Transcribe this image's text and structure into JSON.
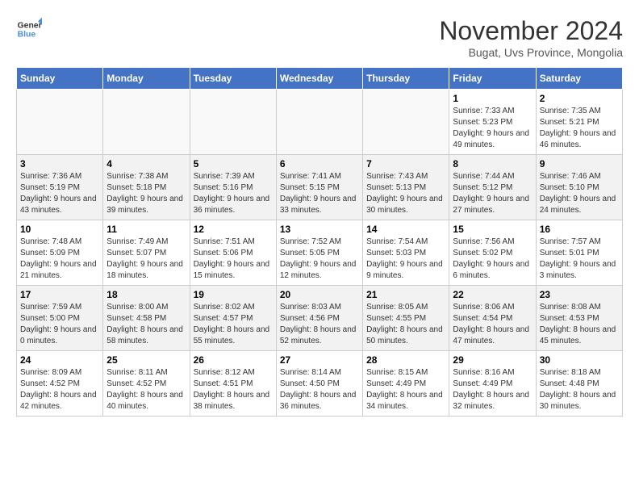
{
  "logo": {
    "line1": "General",
    "line2": "Blue"
  },
  "title": "November 2024",
  "subtitle": "Bugat, Uvs Province, Mongolia",
  "days_of_week": [
    "Sunday",
    "Monday",
    "Tuesday",
    "Wednesday",
    "Thursday",
    "Friday",
    "Saturday"
  ],
  "weeks": [
    [
      {
        "day": "",
        "info": ""
      },
      {
        "day": "",
        "info": ""
      },
      {
        "day": "",
        "info": ""
      },
      {
        "day": "",
        "info": ""
      },
      {
        "day": "",
        "info": ""
      },
      {
        "day": "1",
        "info": "Sunrise: 7:33 AM\nSunset: 5:23 PM\nDaylight: 9 hours and 49 minutes."
      },
      {
        "day": "2",
        "info": "Sunrise: 7:35 AM\nSunset: 5:21 PM\nDaylight: 9 hours and 46 minutes."
      }
    ],
    [
      {
        "day": "3",
        "info": "Sunrise: 7:36 AM\nSunset: 5:19 PM\nDaylight: 9 hours and 43 minutes."
      },
      {
        "day": "4",
        "info": "Sunrise: 7:38 AM\nSunset: 5:18 PM\nDaylight: 9 hours and 39 minutes."
      },
      {
        "day": "5",
        "info": "Sunrise: 7:39 AM\nSunset: 5:16 PM\nDaylight: 9 hours and 36 minutes."
      },
      {
        "day": "6",
        "info": "Sunrise: 7:41 AM\nSunset: 5:15 PM\nDaylight: 9 hours and 33 minutes."
      },
      {
        "day": "7",
        "info": "Sunrise: 7:43 AM\nSunset: 5:13 PM\nDaylight: 9 hours and 30 minutes."
      },
      {
        "day": "8",
        "info": "Sunrise: 7:44 AM\nSunset: 5:12 PM\nDaylight: 9 hours and 27 minutes."
      },
      {
        "day": "9",
        "info": "Sunrise: 7:46 AM\nSunset: 5:10 PM\nDaylight: 9 hours and 24 minutes."
      }
    ],
    [
      {
        "day": "10",
        "info": "Sunrise: 7:48 AM\nSunset: 5:09 PM\nDaylight: 9 hours and 21 minutes."
      },
      {
        "day": "11",
        "info": "Sunrise: 7:49 AM\nSunset: 5:07 PM\nDaylight: 9 hours and 18 minutes."
      },
      {
        "day": "12",
        "info": "Sunrise: 7:51 AM\nSunset: 5:06 PM\nDaylight: 9 hours and 15 minutes."
      },
      {
        "day": "13",
        "info": "Sunrise: 7:52 AM\nSunset: 5:05 PM\nDaylight: 9 hours and 12 minutes."
      },
      {
        "day": "14",
        "info": "Sunrise: 7:54 AM\nSunset: 5:03 PM\nDaylight: 9 hours and 9 minutes."
      },
      {
        "day": "15",
        "info": "Sunrise: 7:56 AM\nSunset: 5:02 PM\nDaylight: 9 hours and 6 minutes."
      },
      {
        "day": "16",
        "info": "Sunrise: 7:57 AM\nSunset: 5:01 PM\nDaylight: 9 hours and 3 minutes."
      }
    ],
    [
      {
        "day": "17",
        "info": "Sunrise: 7:59 AM\nSunset: 5:00 PM\nDaylight: 9 hours and 0 minutes."
      },
      {
        "day": "18",
        "info": "Sunrise: 8:00 AM\nSunset: 4:58 PM\nDaylight: 8 hours and 58 minutes."
      },
      {
        "day": "19",
        "info": "Sunrise: 8:02 AM\nSunset: 4:57 PM\nDaylight: 8 hours and 55 minutes."
      },
      {
        "day": "20",
        "info": "Sunrise: 8:03 AM\nSunset: 4:56 PM\nDaylight: 8 hours and 52 minutes."
      },
      {
        "day": "21",
        "info": "Sunrise: 8:05 AM\nSunset: 4:55 PM\nDaylight: 8 hours and 50 minutes."
      },
      {
        "day": "22",
        "info": "Sunrise: 8:06 AM\nSunset: 4:54 PM\nDaylight: 8 hours and 47 minutes."
      },
      {
        "day": "23",
        "info": "Sunrise: 8:08 AM\nSunset: 4:53 PM\nDaylight: 8 hours and 45 minutes."
      }
    ],
    [
      {
        "day": "24",
        "info": "Sunrise: 8:09 AM\nSunset: 4:52 PM\nDaylight: 8 hours and 42 minutes."
      },
      {
        "day": "25",
        "info": "Sunrise: 8:11 AM\nSunset: 4:52 PM\nDaylight: 8 hours and 40 minutes."
      },
      {
        "day": "26",
        "info": "Sunrise: 8:12 AM\nSunset: 4:51 PM\nDaylight: 8 hours and 38 minutes."
      },
      {
        "day": "27",
        "info": "Sunrise: 8:14 AM\nSunset: 4:50 PM\nDaylight: 8 hours and 36 minutes."
      },
      {
        "day": "28",
        "info": "Sunrise: 8:15 AM\nSunset: 4:49 PM\nDaylight: 8 hours and 34 minutes."
      },
      {
        "day": "29",
        "info": "Sunrise: 8:16 AM\nSunset: 4:49 PM\nDaylight: 8 hours and 32 minutes."
      },
      {
        "day": "30",
        "info": "Sunrise: 8:18 AM\nSunset: 4:48 PM\nDaylight: 8 hours and 30 minutes."
      }
    ]
  ]
}
